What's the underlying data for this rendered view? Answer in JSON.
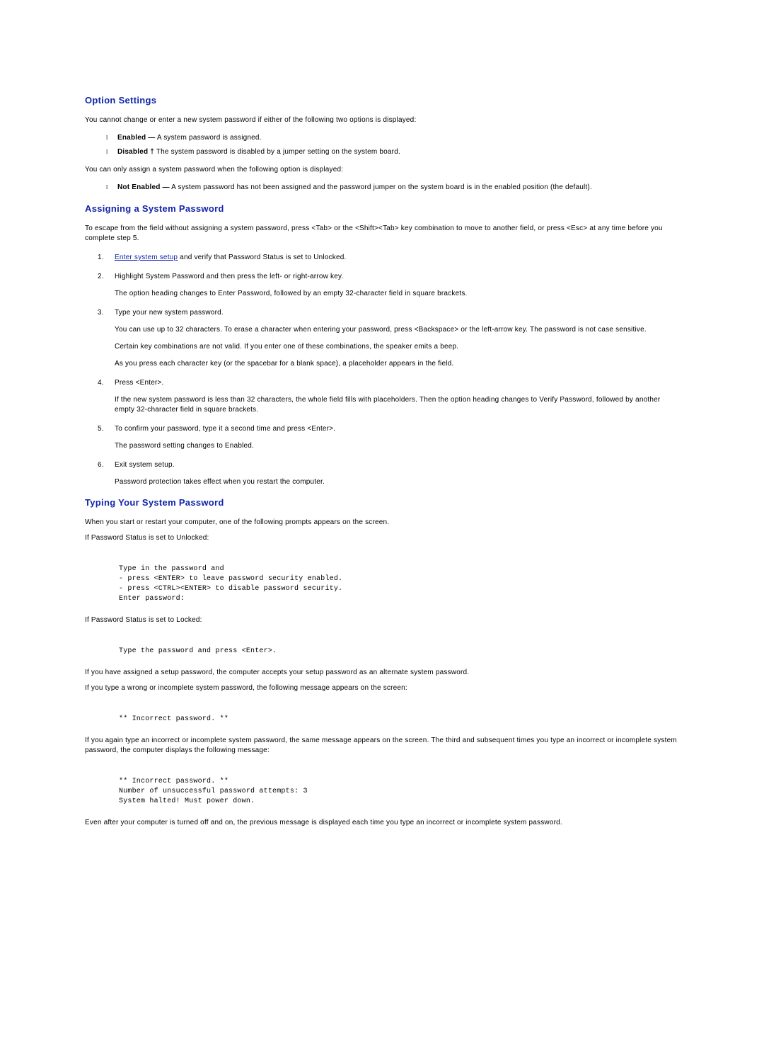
{
  "section1": {
    "heading": "Option Settings",
    "intro": "You cannot change or enter a new system password if either of the following two options is displayed:",
    "bullets": [
      {
        "bold": "Enabled —",
        "rest": " A system password is assigned."
      },
      {
        "bold": "Disabled †",
        "rest": " The system password is disabled by a jumper setting on the system board."
      }
    ],
    "mid": "You can only assign a system password when the following option is displayed:",
    "bullets2": [
      {
        "bold": "Not Enabled —",
        "rest": " A system password has not been assigned and the password jumper on the system board is in the enabled position (the default)."
      }
    ]
  },
  "section2": {
    "heading": "Assigning a System Password",
    "intro": "To escape from the field without assigning a system password, press <Tab> or the <Shift><Tab> key combination to move to another field, or press <Esc> at any time before you complete step 5.",
    "steps": [
      {
        "pre_link": "",
        "link": "Enter system setup",
        "post_link": " and verify that Password Status is set to Unlocked."
      },
      {
        "main": "Highlight System Password and then press the left- or right-arrow key.",
        "sub1": "The option heading changes to Enter Password, followed by an empty 32-character field in square brackets."
      },
      {
        "main": "Type your new system password.",
        "sub1": "You can use up to 32 characters. To erase a character when entering your password, press <Backspace> or the left-arrow key. The password is not case sensitive.",
        "sub2": "Certain key combinations are not valid. If you enter one of these combinations, the speaker emits a beep.",
        "sub3": "As you press each character key (or the spacebar for a blank space), a placeholder appears in the field."
      },
      {
        "main": "Press <Enter>.",
        "sub1": "If the new system password is less than 32 characters, the whole field fills with placeholders. Then the option heading changes to Verify Password, followed by another empty 32-character field in square brackets."
      },
      {
        "main": "To confirm your password, type it a second time and press <Enter>.",
        "sub1": "The password setting changes to Enabled."
      },
      {
        "main": "Exit system setup.",
        "sub1": "Password protection takes effect when you restart the computer."
      }
    ]
  },
  "section3": {
    "heading": "Typing Your System Password",
    "p1": "When you start or restart your computer, one of the following prompts appears on the screen.",
    "p2": "If Password Status is set to Unlocked:",
    "code1": "Type in the password and\n- press <ENTER> to leave password security enabled.\n- press <CTRL><ENTER> to disable password security.\nEnter password:",
    "p3": "If Password Status is set to Locked:",
    "code2": "Type the password and press <Enter>.",
    "p4": "If you have assigned a setup password, the computer accepts your setup password as an alternate system password.",
    "p5": "If you type a wrong or incomplete system password, the following message appears on the screen:",
    "code3": "** Incorrect password. **",
    "p6": "If you again type an incorrect or incomplete system password, the same message appears on the screen. The third and subsequent times you type an incorrect or incomplete system password, the computer displays the following message:",
    "code4": "** Incorrect password. **\nNumber of unsuccessful password attempts: 3\nSystem halted! Must power down.",
    "p7": "Even after your computer is turned off and on, the previous message is displayed each time you type an incorrect or incomplete system password."
  }
}
